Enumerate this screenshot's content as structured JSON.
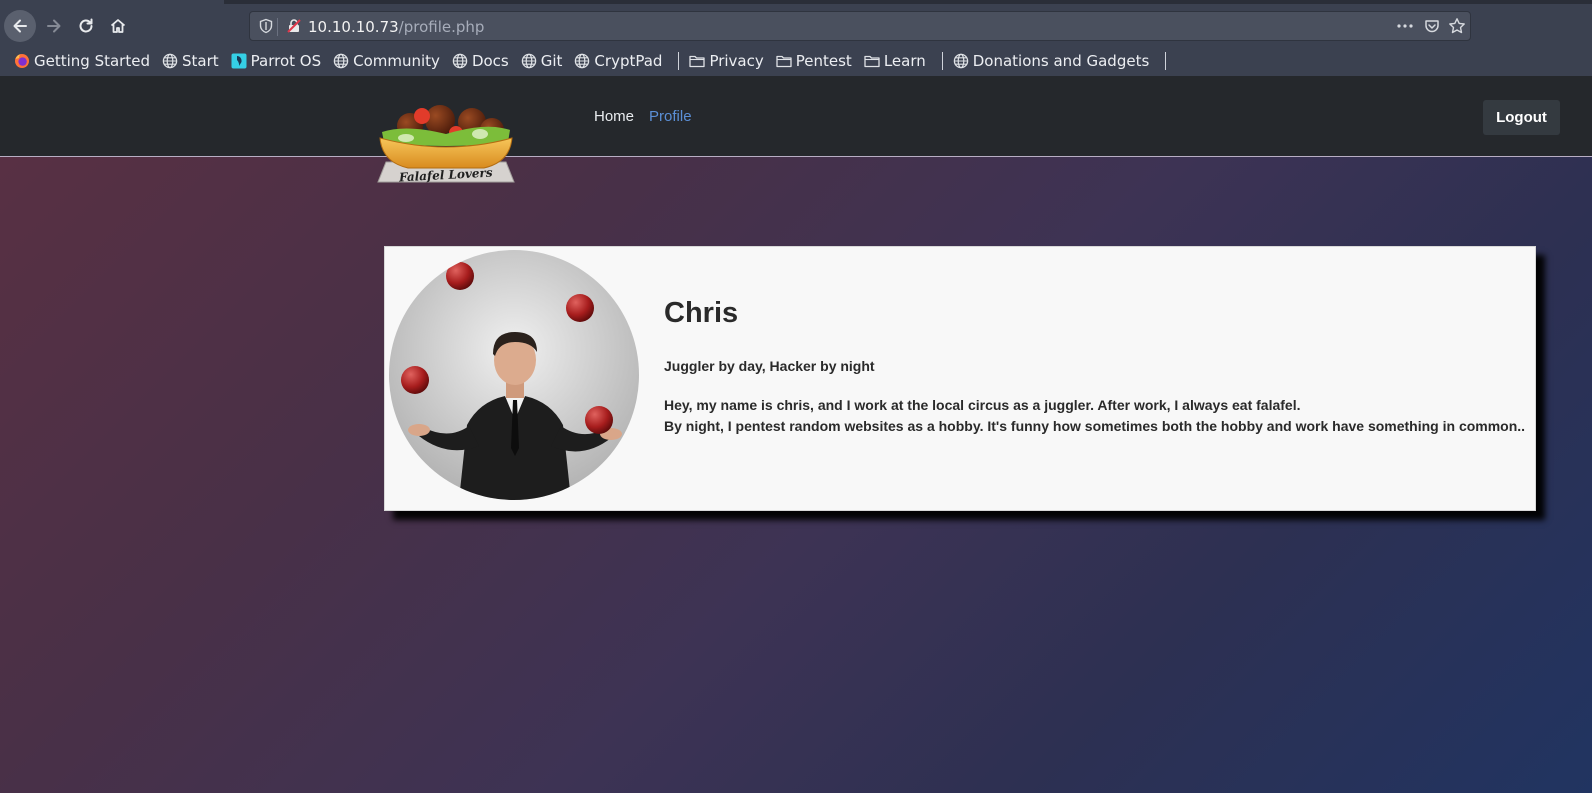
{
  "browser": {
    "url_host": "10.10.10.73",
    "url_path": "/profile.php",
    "bookmarks": [
      {
        "label": "Getting Started",
        "icon": "firefox-icon"
      },
      {
        "label": "Start",
        "icon": "globe-icon"
      },
      {
        "label": "Parrot OS",
        "icon": "parrot-icon"
      },
      {
        "label": "Community",
        "icon": "globe-icon"
      },
      {
        "label": "Docs",
        "icon": "globe-icon"
      },
      {
        "label": "Git",
        "icon": "globe-icon"
      },
      {
        "label": "CryptPad",
        "icon": "globe-icon"
      },
      {
        "label": "Privacy",
        "icon": "folder-icon"
      },
      {
        "label": "Pentest",
        "icon": "folder-icon"
      },
      {
        "label": "Learn",
        "icon": "folder-icon"
      },
      {
        "label": "Donations and Gadgets",
        "icon": "globe-icon"
      }
    ]
  },
  "site": {
    "logo_text": "Falafel Lovers",
    "nav": {
      "home": "Home",
      "profile": "Profile"
    },
    "logout_label": "Logout"
  },
  "profile": {
    "name": "Chris",
    "tagline": "Juggler by day, Hacker by night",
    "bio_line1": "Hey, my name is chris, and I work at the local circus as a juggler. After work, I always eat falafel.",
    "bio_line2": "By night, I pentest random websites as a hobby. It's funny how sometimes both the hobby and work have something in common.."
  }
}
